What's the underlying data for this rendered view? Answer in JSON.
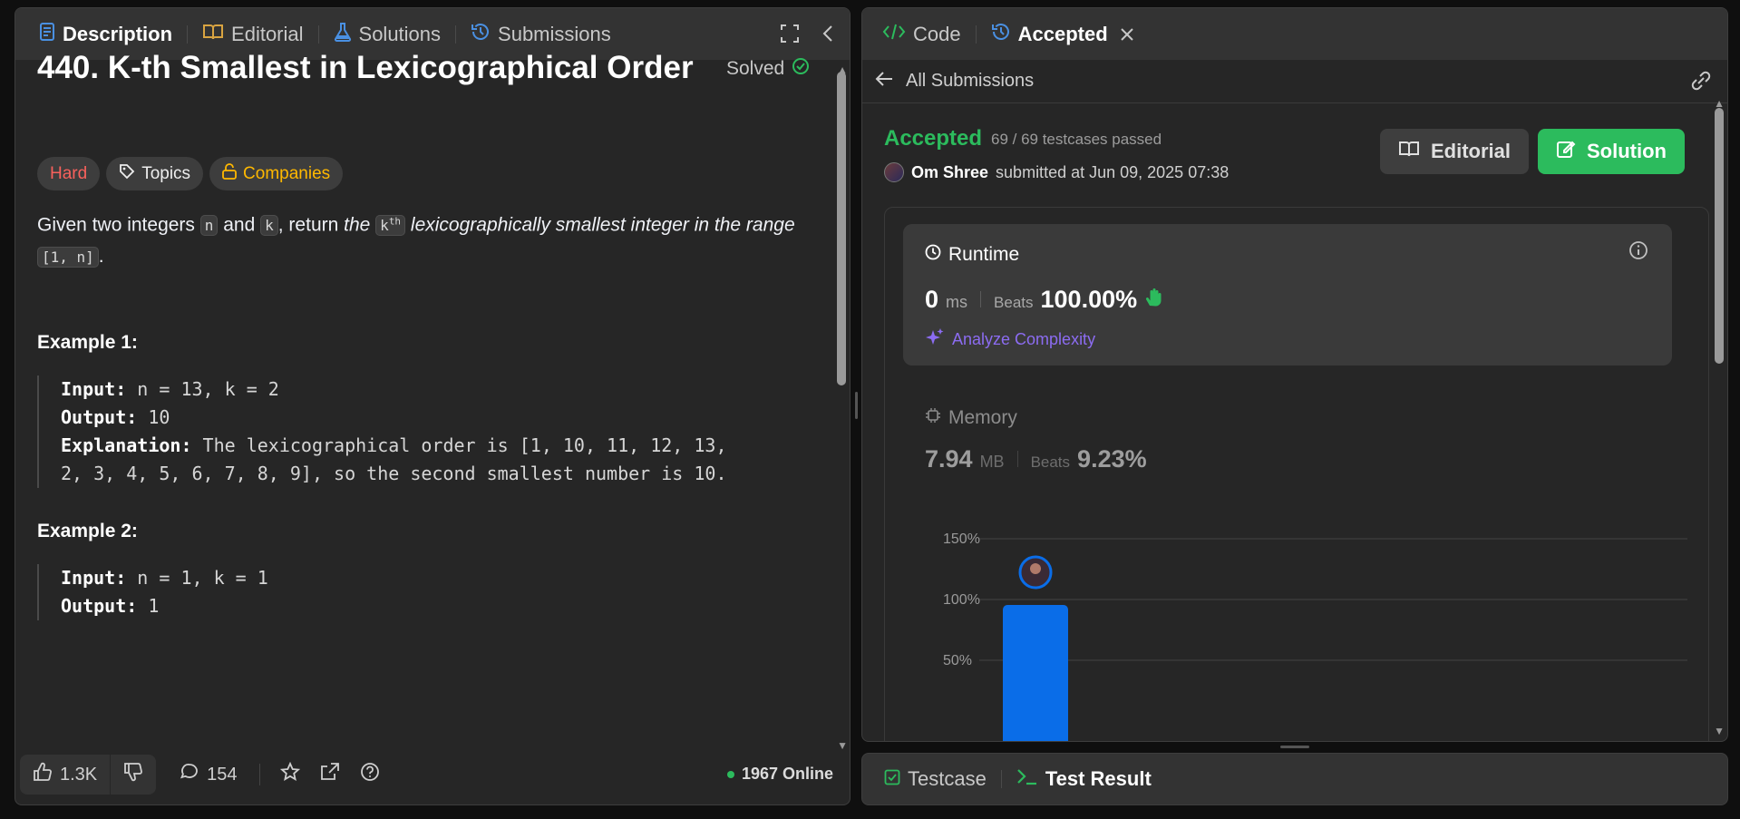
{
  "left_panel": {
    "tabs": [
      {
        "label": "Description",
        "icon": "description-icon",
        "color": "#4a90e2"
      },
      {
        "label": "Editorial",
        "icon": "book-icon",
        "color": "#d9a441"
      },
      {
        "label": "Solutions",
        "icon": "flask-icon",
        "color": "#4a90e2"
      },
      {
        "label": "Submissions",
        "icon": "history-icon",
        "color": "#4a90e2"
      }
    ],
    "problem": {
      "title": "440. K-th Smallest in Lexicographical Order",
      "status": "Solved",
      "tags": {
        "difficulty": "Hard",
        "topics": "Topics",
        "companies": "Companies"
      },
      "statement": {
        "part1": "Given two integers ",
        "n": "n",
        "part2": " and ",
        "k": "k",
        "part3": ", return ",
        "italic1": "the ",
        "kth_base": "k",
        "kth_sup": "th",
        "italic2": " lexicographically smallest integer in the range ",
        "range": "[1, n]",
        "end": "."
      },
      "examples": [
        {
          "title": "Example 1:",
          "input_label": "Input:",
          "input": " n = 13, k = 2",
          "output_label": "Output:",
          "output": " 10",
          "explanation_label": "Explanation:",
          "explanation_line1": " The lexicographical order is [1, 10, 11, 12, 13,",
          "explanation_line2": "2, 3, 4, 5, 6, 7, 8, 9], so the second smallest number is 10."
        },
        {
          "title": "Example 2:",
          "input_label": "Input:",
          "input": " n = 1, k = 1",
          "output_label": "Output:",
          "output": " 1"
        }
      ]
    },
    "bottom": {
      "likes": "1.3K",
      "comments": "154",
      "online": "1967 Online"
    }
  },
  "right_panel": {
    "tabs": [
      {
        "label": "Code",
        "icon": "code-icon"
      },
      {
        "label": "Accepted",
        "icon": "history-icon"
      }
    ],
    "back_label": "All Submissions",
    "result": {
      "status": "Accepted",
      "testcases": "69 / 69 testcases passed",
      "user": "Om Shree",
      "submitted": "submitted at Jun 09, 2025 07:38"
    },
    "buttons": {
      "editorial": "Editorial",
      "solution": "Solution"
    },
    "runtime": {
      "title": "Runtime",
      "value": "0",
      "unit": "ms",
      "beats_label": "Beats",
      "beats": "100.00%",
      "analyze": "Analyze Complexity"
    },
    "memory": {
      "title": "Memory",
      "value": "7.94",
      "unit": "MB",
      "beats_label": "Beats",
      "beats": "9.23%"
    },
    "colors": {
      "accepted": "#2cbb5d",
      "bar": "#0a6de8",
      "analyze": "#8c6cf2"
    }
  },
  "chart_data": {
    "type": "bar",
    "y_ticks": [
      "150%",
      "100%",
      "50%"
    ],
    "ylim": [
      0,
      150
    ],
    "bars": [
      {
        "value": 100,
        "highlighted": true
      }
    ]
  },
  "bottom_tabs": [
    {
      "label": "Testcase",
      "icon": "checkbox-icon"
    },
    {
      "label": "Test Result",
      "icon": "terminal-icon"
    }
  ]
}
